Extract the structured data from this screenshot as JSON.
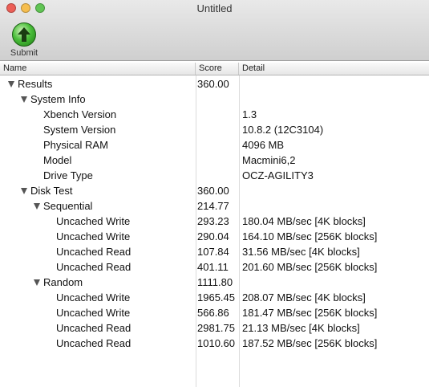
{
  "window": {
    "title": "Untitled",
    "traffic_lights": [
      "#ec5f57",
      "#f6be4f",
      "#61c554"
    ]
  },
  "toolbar": {
    "submit_label": "Submit"
  },
  "columns": {
    "name": "Name",
    "score": "Score",
    "detail": "Detail"
  },
  "rows": [
    {
      "name": "Results",
      "score": "360.00",
      "detail": "",
      "level": 0,
      "expandable": true
    },
    {
      "name": "System Info",
      "score": "",
      "detail": "",
      "level": 1,
      "expandable": true
    },
    {
      "name": "Xbench Version",
      "score": "",
      "detail": "1.3",
      "level": 2,
      "expandable": false
    },
    {
      "name": "System Version",
      "score": "",
      "detail": "10.8.2 (12C3104)",
      "level": 2,
      "expandable": false
    },
    {
      "name": "Physical RAM",
      "score": "",
      "detail": "4096 MB",
      "level": 2,
      "expandable": false
    },
    {
      "name": "Model",
      "score": "",
      "detail": "Macmini6,2",
      "level": 2,
      "expandable": false
    },
    {
      "name": "Drive Type",
      "score": "",
      "detail": "OCZ-AGILITY3",
      "level": 2,
      "expandable": false
    },
    {
      "name": "Disk Test",
      "score": "360.00",
      "detail": "",
      "level": 1,
      "expandable": true
    },
    {
      "name": "Sequential",
      "score": "214.77",
      "detail": "",
      "level": 2,
      "expandable": true
    },
    {
      "name": "Uncached Write",
      "score": "293.23",
      "detail": "180.04 MB/sec [4K blocks]",
      "level": 3,
      "expandable": false
    },
    {
      "name": "Uncached Write",
      "score": "290.04",
      "detail": "164.10 MB/sec [256K blocks]",
      "level": 3,
      "expandable": false
    },
    {
      "name": "Uncached Read",
      "score": "107.84",
      "detail": "31.56 MB/sec [4K blocks]",
      "level": 3,
      "expandable": false
    },
    {
      "name": "Uncached Read",
      "score": "401.11",
      "detail": "201.60 MB/sec [256K blocks]",
      "level": 3,
      "expandable": false
    },
    {
      "name": "Random",
      "score": "1111.80",
      "detail": "",
      "level": 2,
      "expandable": true
    },
    {
      "name": "Uncached Write",
      "score": "1965.45",
      "detail": "208.07 MB/sec [4K blocks]",
      "level": 3,
      "expandable": false
    },
    {
      "name": "Uncached Write",
      "score": "566.86",
      "detail": "181.47 MB/sec [256K blocks]",
      "level": 3,
      "expandable": false
    },
    {
      "name": "Uncached Read",
      "score": "2981.75",
      "detail": "21.13 MB/sec [4K blocks]",
      "level": 3,
      "expandable": false
    },
    {
      "name": "Uncached Read",
      "score": "1010.60",
      "detail": "187.52 MB/sec [256K blocks]",
      "level": 3,
      "expandable": false
    }
  ]
}
